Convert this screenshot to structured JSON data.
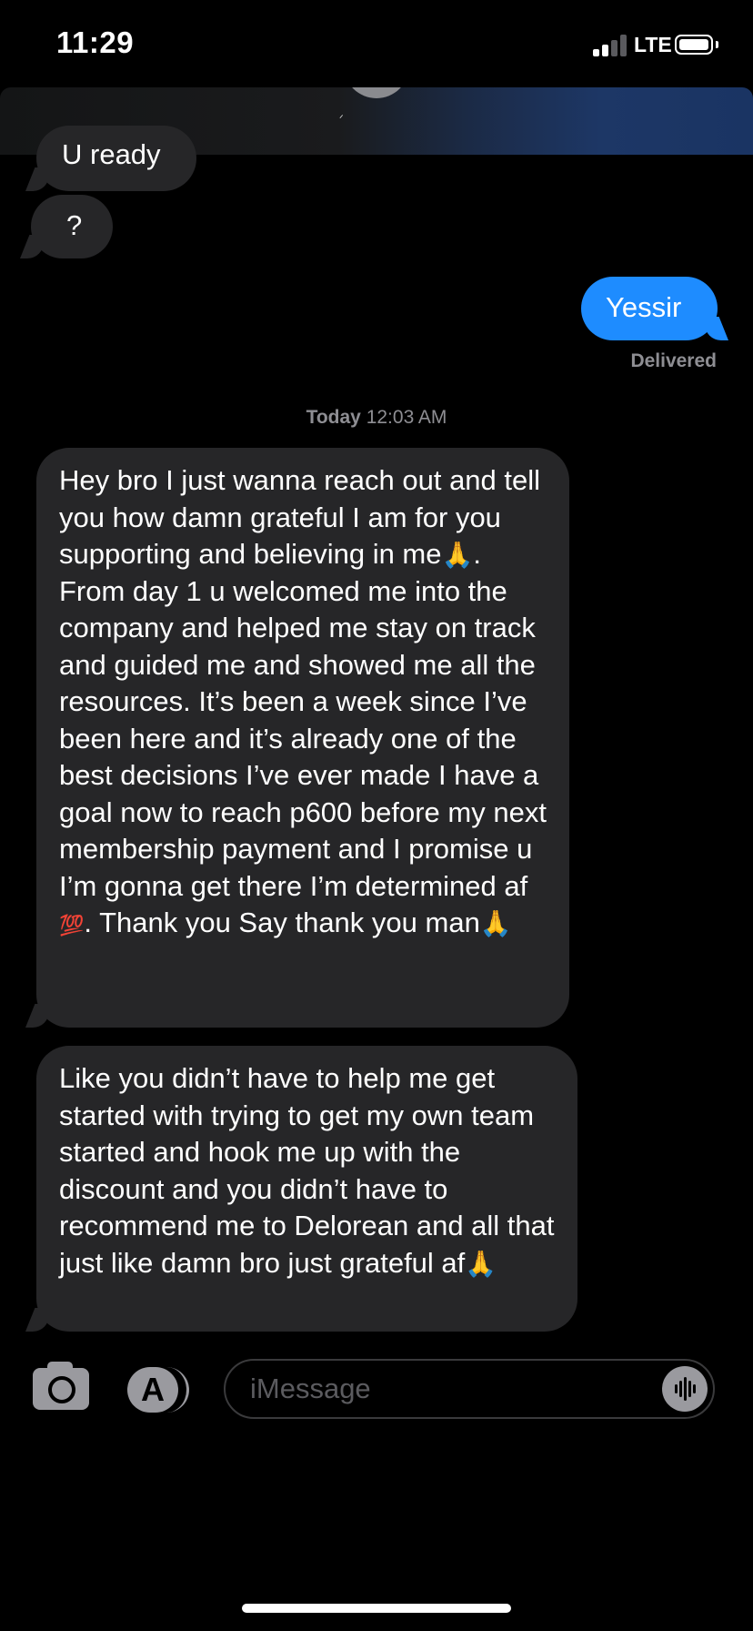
{
  "status_bar": {
    "time": "11:29",
    "network": "LTE"
  },
  "icons": {
    "signal": "signal-bars-icon",
    "battery": "battery-icon",
    "camera": "camera-icon",
    "apps": "app-store-icon",
    "audio": "audio-waveform-icon"
  },
  "messages": {
    "partial": "U ready",
    "question": "?",
    "outgoing": "Yessir",
    "delivered": "Delivered",
    "timestamp_day": "Today",
    "timestamp_time": "12:03 AM",
    "msg1_part1": "Hey bro I just wanna reach out and tell you how damn grateful I am for you supporting and believing in me",
    "msg1_part2": ". From day 1 u welcomed me into the company and helped me stay on track and guided me and showed me all the resources. It’s been a week since I’ve been here and it’s already one of the best decisions I’ve ever made I have a goal now to reach p600 before my next membership payment and I promise u I’m gonna get there I’m determined af",
    "msg1_part3": ". Thank you Say thank you man",
    "msg2": "Like you didn’t have to help me get started with trying to get my own team started and hook me up with the discount and you didn’t have to recommend me to Delorean and all that just like damn bro just grateful af",
    "emoji_pray": "🙏",
    "emoji_hundred": "💯"
  },
  "input": {
    "placeholder": "iMessage"
  },
  "colors": {
    "incoming_bubble": "#262628",
    "outgoing_bubble": "#1e8cff",
    "secondary_text": "#8e8e93"
  }
}
